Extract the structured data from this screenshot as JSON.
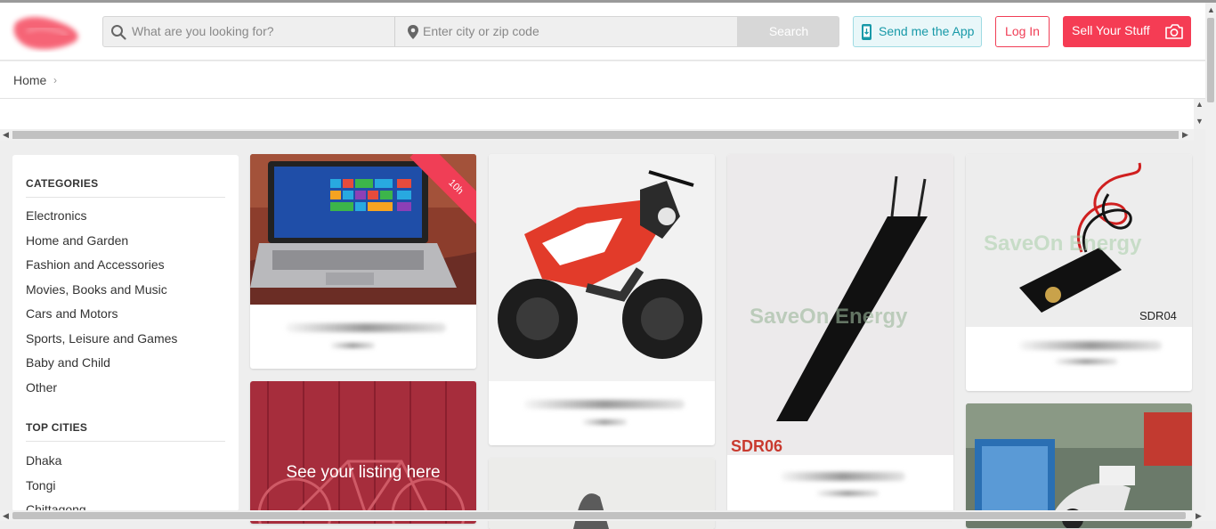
{
  "header": {
    "search_placeholder": "What are you looking for?",
    "location_placeholder": "Enter city or zip code",
    "search_button": "Search",
    "app_button": "Send me the App",
    "login_button": "Log In",
    "sell_button": "Sell Your Stuff",
    "accent_color": "#f53c54",
    "app_color": "#1799a8"
  },
  "breadcrumb": {
    "home": "Home",
    "separator": "›"
  },
  "sidebar": {
    "categories_title": "CATEGORIES",
    "categories": [
      "Electronics",
      "Home and Garden",
      "Fashion and Accessories",
      "Movies, Books and Music",
      "Cars and Motors",
      "Sports, Leisure and Games",
      "Baby and Child",
      "Other"
    ],
    "cities_title": "TOP CITIES",
    "cities": [
      "Dhaka",
      "Tongi",
      "Chittagong"
    ]
  },
  "listings": {
    "laptop_badge": "10h",
    "promo_text": "See your listing here",
    "rod_label": "SDR06",
    "rod_watermark": "SaveOn Energy",
    "connector_label": "SDR04",
    "connector_watermark": "SaveOn Energy"
  }
}
